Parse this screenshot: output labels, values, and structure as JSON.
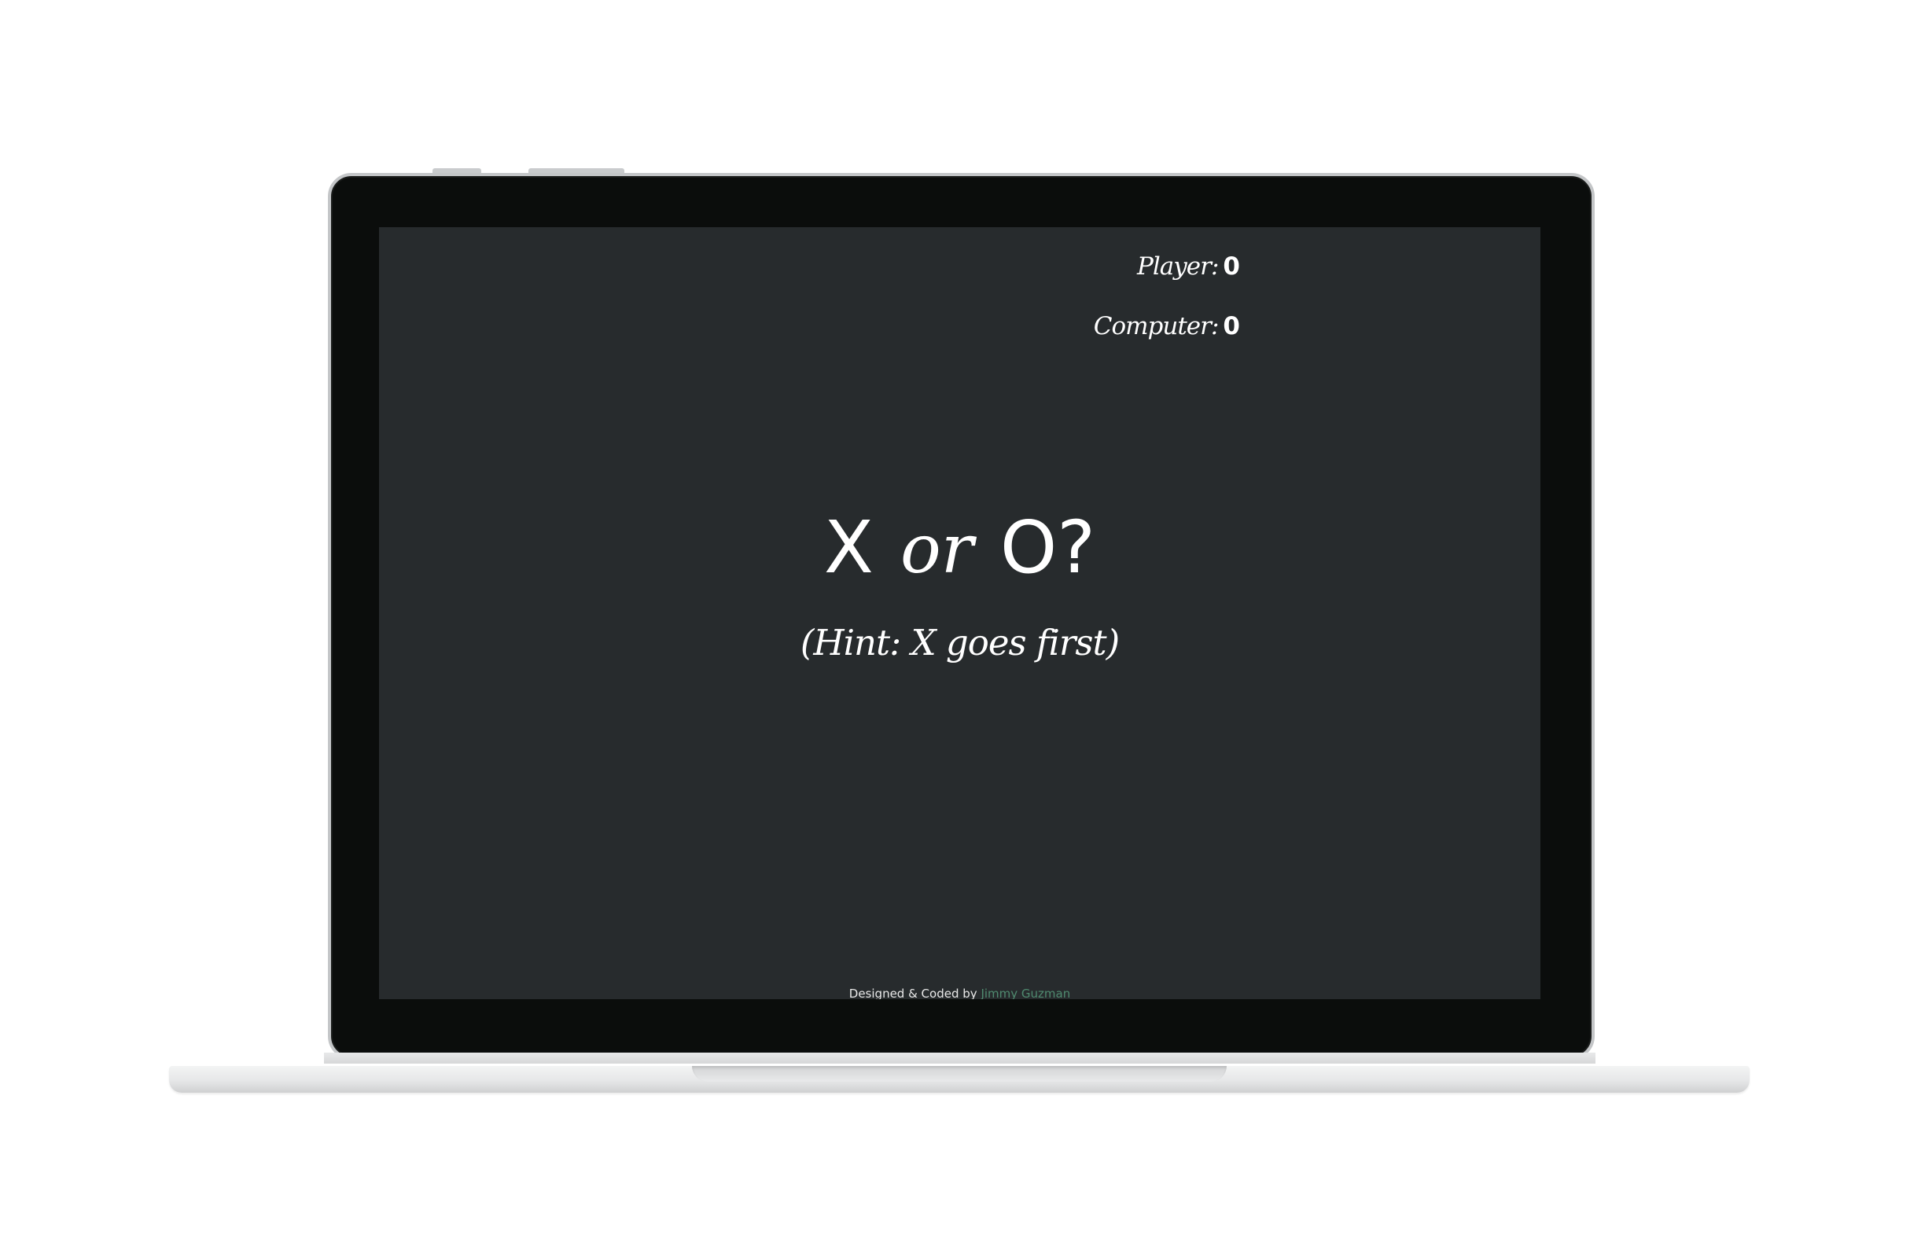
{
  "scoreboard": {
    "player_label": "Player:",
    "player_score": "0",
    "computer_label": "Computer:",
    "computer_score": "0"
  },
  "prompt": {
    "option_x": "X",
    "connector": "or",
    "option_o": "O?",
    "hint": "(Hint: X goes first)"
  },
  "footer": {
    "credit_text": "Designed & Coded by",
    "author_link": "Jimmy Guzman"
  },
  "colors": {
    "screen_background": "#272b2d",
    "text": "#ffffff",
    "link": "#4f8a6f",
    "bezel": "#0b0d0c"
  }
}
